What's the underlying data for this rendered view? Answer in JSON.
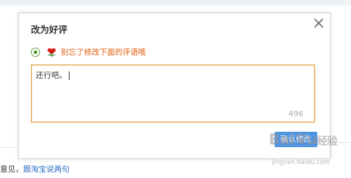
{
  "dialog": {
    "title": "改为好评",
    "close_icon": "close-icon",
    "reminder": {
      "icon": "flower-icon",
      "text": "别忘了修改下面的评语哦",
      "color": "#e15b0a"
    },
    "review": {
      "value": "还行吧。",
      "remaining_chars": "496"
    },
    "confirm_label": "确认修改",
    "accent": "#4d95e0"
  },
  "background_page": {
    "text_prefix": "意见，",
    "link_text": "跟淘宝说两句"
  },
  "watermark": {
    "logo": "Baidu",
    "logo_suffix": "经验",
    "url": "jingyan.baidu.com"
  }
}
